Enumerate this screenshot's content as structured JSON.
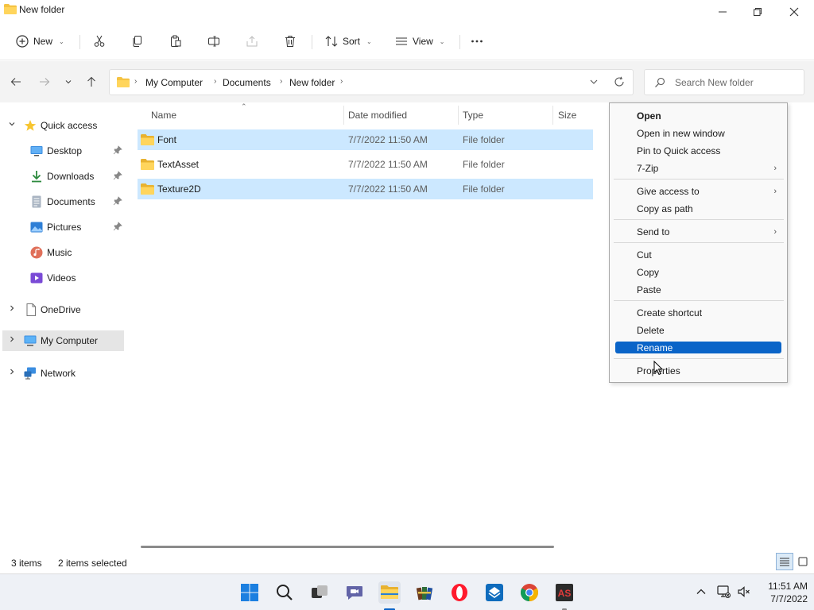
{
  "window": {
    "title": "New folder"
  },
  "commandbar": {
    "new_label": "New",
    "sort_label": "Sort",
    "view_label": "View"
  },
  "address": {
    "crumbs": [
      "My Computer",
      "Documents",
      "New folder"
    ],
    "search_placeholder": "Search New folder"
  },
  "sidebar": {
    "quick_access": "Quick access",
    "items": [
      {
        "label": "Desktop",
        "icon": "desktop-icon",
        "pinned": true
      },
      {
        "label": "Downloads",
        "icon": "downloads-icon",
        "pinned": true
      },
      {
        "label": "Documents",
        "icon": "documents-icon",
        "pinned": true
      },
      {
        "label": "Pictures",
        "icon": "pictures-icon",
        "pinned": true
      },
      {
        "label": "Music",
        "icon": "music-icon",
        "pinned": false
      },
      {
        "label": "Videos",
        "icon": "videos-icon",
        "pinned": false
      }
    ],
    "onedrive": "OneDrive",
    "mycomputer": "My Computer",
    "network": "Network"
  },
  "columns": {
    "name": "Name",
    "date": "Date modified",
    "type": "Type",
    "size": "Size"
  },
  "files": [
    {
      "name": "Font",
      "date": "7/7/2022 11:50 AM",
      "type": "File folder",
      "selected": true
    },
    {
      "name": "TextAsset",
      "date": "7/7/2022 11:50 AM",
      "type": "File folder",
      "selected": false
    },
    {
      "name": "Texture2D",
      "date": "7/7/2022 11:50 AM",
      "type": "File folder",
      "selected": true
    }
  ],
  "status": {
    "items": "3 items",
    "selected": "2 items selected"
  },
  "context_menu": {
    "open": "Open",
    "open_new_window": "Open in new window",
    "pin_quick_access": "Pin to Quick access",
    "zip": "7-Zip",
    "give_access": "Give access to",
    "copy_path": "Copy as path",
    "send_to": "Send to",
    "cut": "Cut",
    "copy": "Copy",
    "paste": "Paste",
    "create_shortcut": "Create shortcut",
    "delete": "Delete",
    "rename": "Rename",
    "properties": "Properties"
  },
  "clock": {
    "time": "11:51 AM",
    "date": "7/7/2022"
  },
  "colors": {
    "selection": "#cce8ff",
    "menu_highlight": "#0a64c8",
    "folder": "#f5c342"
  }
}
